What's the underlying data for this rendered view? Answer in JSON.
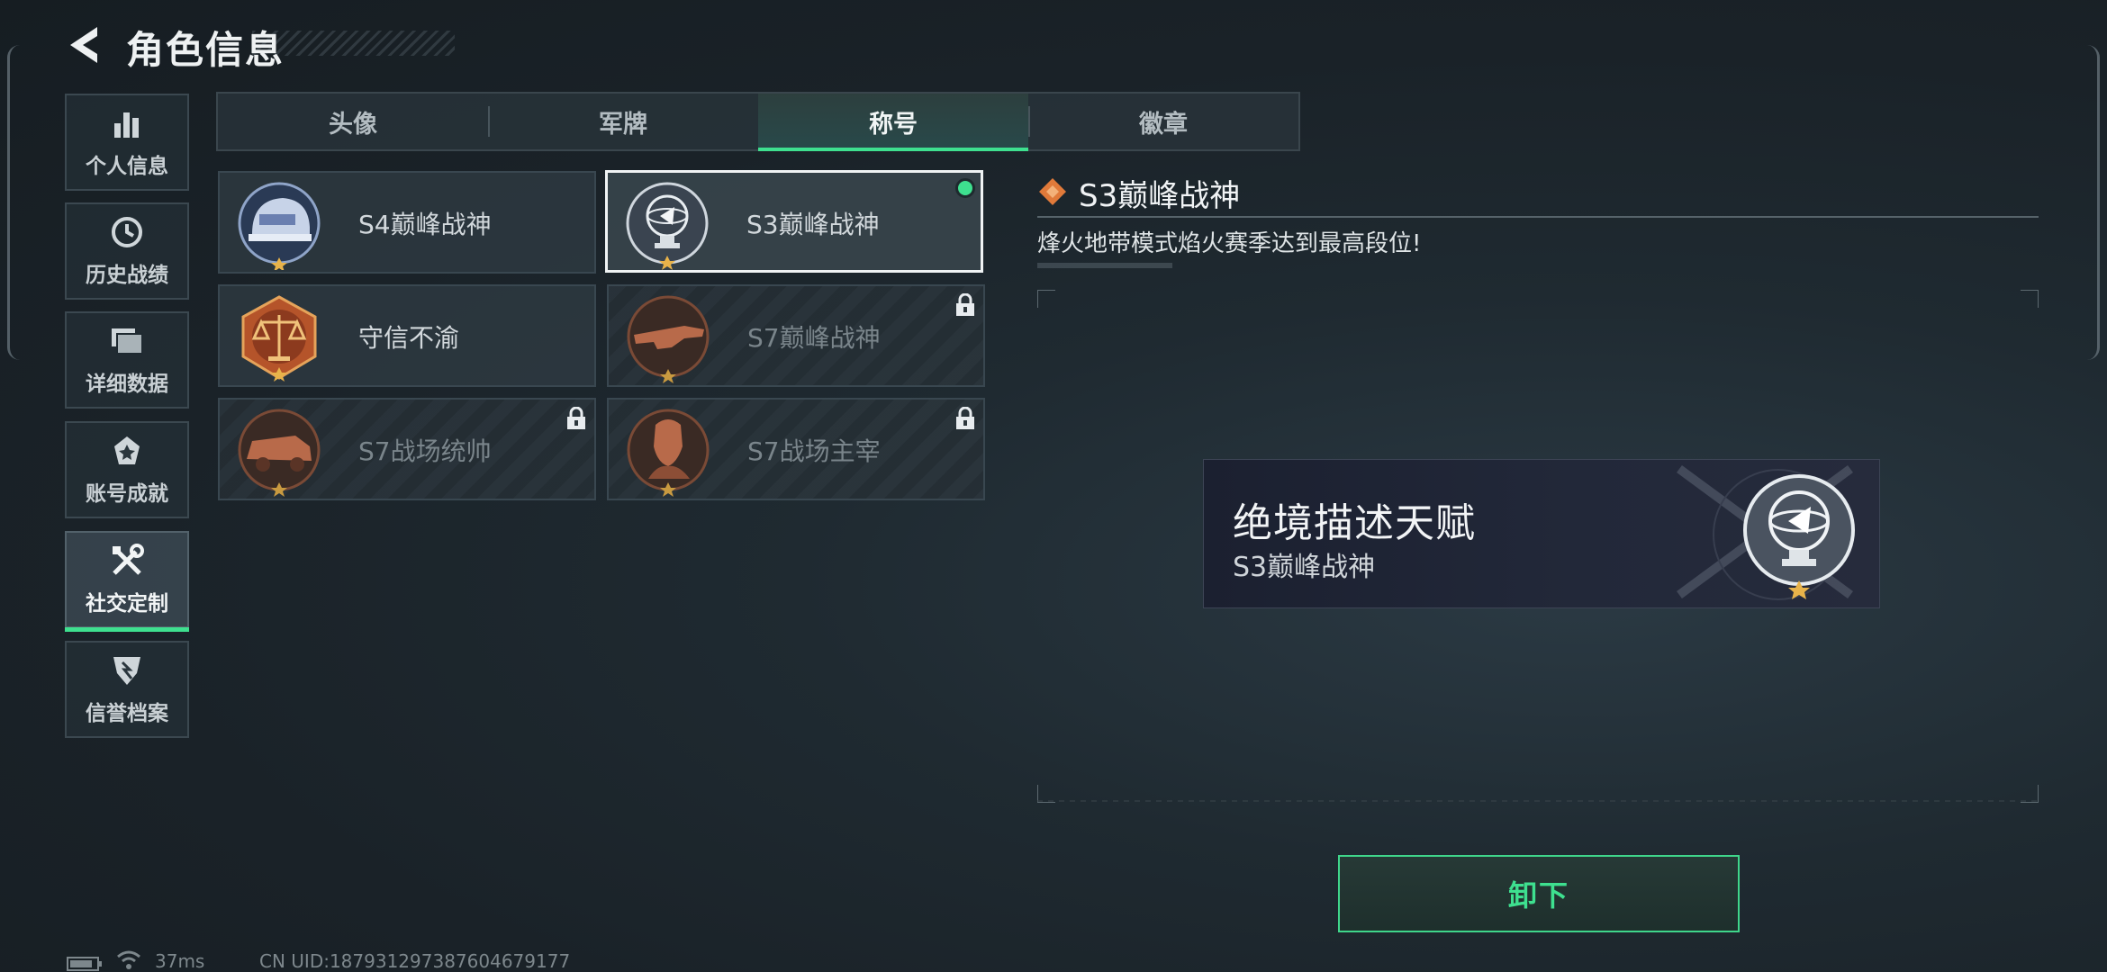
{
  "header": {
    "title": "角色信息",
    "back_icon": "back-arrow-icon"
  },
  "sidebar": {
    "items": [
      {
        "label": "个人信息",
        "icon": "bar-chart-icon",
        "active": false
      },
      {
        "label": "历史战绩",
        "icon": "clock-icon",
        "active": false
      },
      {
        "label": "详细数据",
        "icon": "folders-icon",
        "active": false
      },
      {
        "label": "账号成就",
        "icon": "achievement-icon",
        "active": false
      },
      {
        "label": "社交定制",
        "icon": "tools-icon",
        "active": true
      },
      {
        "label": "信誉档案",
        "icon": "shield-icon",
        "active": false
      }
    ]
  },
  "tabs": [
    {
      "label": "头像",
      "active": false
    },
    {
      "label": "军牌",
      "active": false
    },
    {
      "label": "称号",
      "active": true
    },
    {
      "label": "徽章",
      "active": false
    }
  ],
  "titles": [
    {
      "name": "S4巅峰战神",
      "medal": "helmet-medal-icon",
      "locked": false,
      "selected": false,
      "equipped": false
    },
    {
      "name": "S3巅峰战神",
      "medal": "globe-trophy-medal-icon",
      "locked": false,
      "selected": true,
      "equipped": true
    },
    {
      "name": "守信不渝",
      "medal": "scales-medal-icon",
      "locked": false,
      "selected": false,
      "equipped": false
    },
    {
      "name": "S7巅峰战神",
      "medal": "rifle-medal-icon",
      "locked": true,
      "selected": false,
      "equipped": false
    },
    {
      "name": "S7战场统帅",
      "medal": "vehicle-medal-icon",
      "locked": true,
      "selected": false,
      "equipped": false
    },
    {
      "name": "S7战场主宰",
      "medal": "soldier-medal-icon",
      "locked": true,
      "selected": false,
      "equipped": false
    }
  ],
  "detail": {
    "title": "S3巅峰战神",
    "description": "烽火地带模式焰火赛季达到最高段位!",
    "title_icon": "diamond-icon"
  },
  "nameplate": {
    "title": "绝境描述天赋",
    "subtitle": "S3巅峰战神",
    "medal": "globe-trophy-medal-icon"
  },
  "actions": {
    "unequip_label": "卸下"
  },
  "status_bar": {
    "ping": "37ms",
    "uid": "CN UID:187931297387604679177",
    "battery_icon": "battery-icon",
    "wifi_icon": "wifi-icon"
  },
  "colors": {
    "accent": "#3ee08f",
    "background": "#1c252b",
    "medal_orange": "#e07a3a"
  }
}
